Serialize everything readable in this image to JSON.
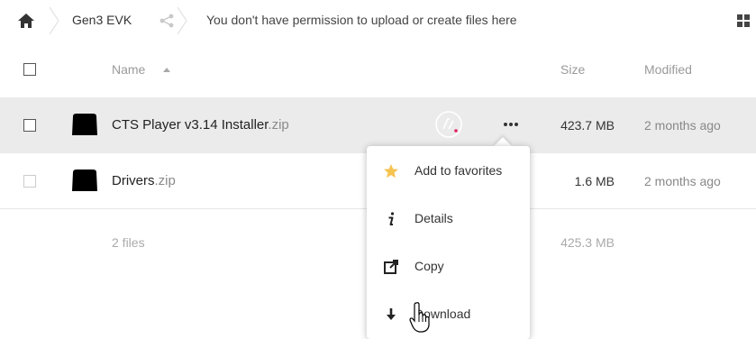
{
  "breadcrumb": {
    "home_icon": "home-icon",
    "folder": "Gen3 EVK",
    "share_icon": "share-icon",
    "message": "You don't have permission to upload or create files here"
  },
  "view_toggle_icon": "grid-view-icon",
  "table": {
    "headers": {
      "name": "Name",
      "size": "Size",
      "modified": "Modified"
    },
    "sort": {
      "column": "name",
      "direction": "ascending"
    },
    "rows": [
      {
        "basename": "CTS Player v3.14 Installer",
        "ext": ".zip",
        "size": "423.7 MB",
        "modified": "2 months ago",
        "highlighted": true
      },
      {
        "basename": "Drivers",
        "ext": ".zip",
        "size": "1.6 MB",
        "modified": "2 months ago",
        "highlighted": false
      }
    ],
    "summary": {
      "files": "2 files",
      "size": "425.3 MB"
    }
  },
  "context_menu": {
    "items": [
      {
        "label": "Add to favorites",
        "icon": "star-icon"
      },
      {
        "label": "Details",
        "icon": "info-icon"
      },
      {
        "label": "Copy",
        "icon": "external-link-icon"
      },
      {
        "label": "Download",
        "icon": "download-icon"
      }
    ]
  },
  "colors": {
    "highlight_row": "#ebebeb",
    "star": "#f5c451",
    "status_dot": "#e0245e"
  }
}
